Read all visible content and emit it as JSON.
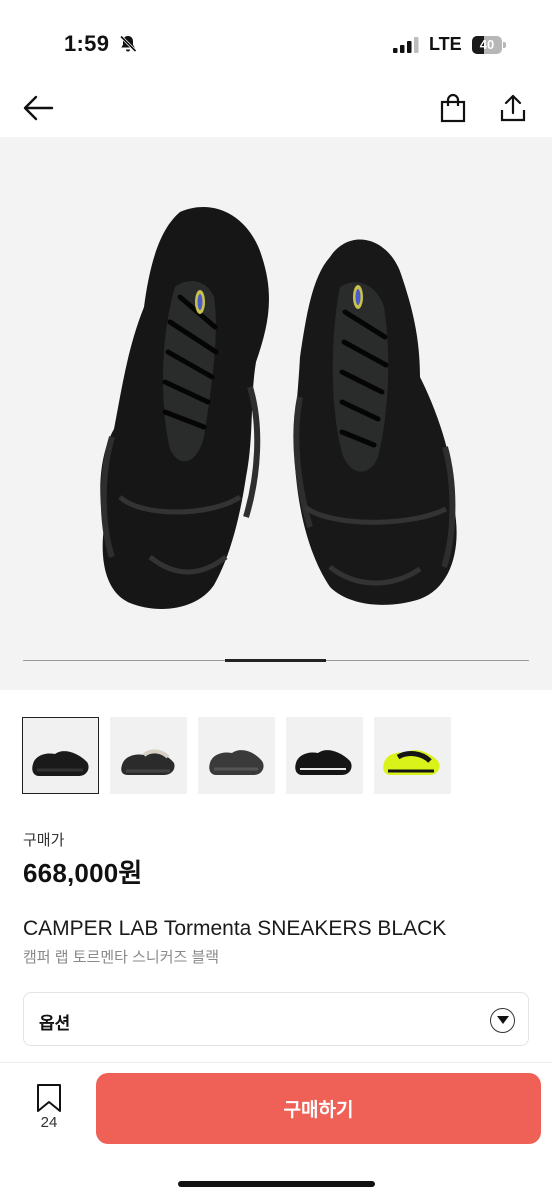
{
  "status": {
    "time": "1:59",
    "network": "LTE",
    "battery": "40"
  },
  "icons": {
    "back": "arrow-left-icon",
    "bag": "shopping-bag-icon",
    "share": "share-icon",
    "mute": "bell-slash-icon",
    "dropdown": "chevron-down-icon",
    "bookmark": "bookmark-icon"
  },
  "product": {
    "price_label": "구매가",
    "price": "668,000원",
    "title": "CAMPER LAB Tormenta SNEAKERS BLACK",
    "subtitle": "캠퍼 랩 토르멘타 스니커즈 블랙"
  },
  "gallery": {
    "thumbnails": [
      "black-side",
      "black-white-side",
      "black-gray-side",
      "black-pair-side",
      "neon-yellow-side"
    ],
    "selected_index": 0,
    "position_fraction": 0.4
  },
  "option": {
    "label": "옵션"
  },
  "footer": {
    "bookmark_count": "24",
    "buy_label": "구매하기"
  },
  "colors": {
    "accent": "#ef6156",
    "hero_background": "#f3f3f3"
  }
}
